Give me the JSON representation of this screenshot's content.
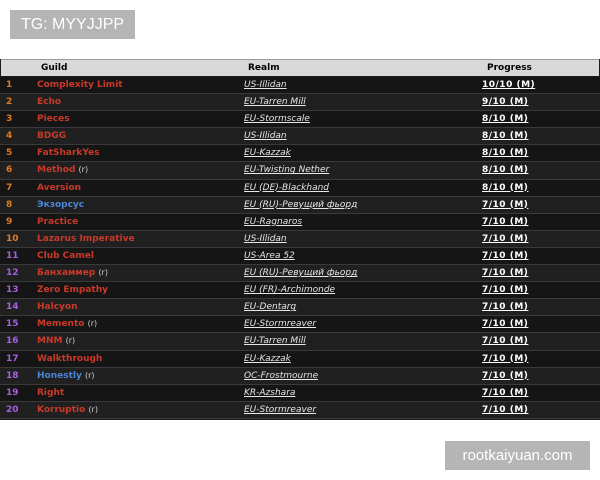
{
  "watermark_top": "TG: MYYJJPP",
  "watermark_bottom": "rootkaiyuan.com",
  "table": {
    "headers": {
      "guild": "Guild",
      "realm": "Realm",
      "progress": "Progress"
    },
    "colors": {
      "horde": "#c93a2a",
      "alliance": "#4a86d6",
      "rank_orange": "#e07a24",
      "rank_purple": "#a560e0",
      "rank_blue": "#4a86d6"
    },
    "rows": [
      {
        "rank": "1",
        "guild": "Complexity Limit",
        "suffix": "",
        "realm": "US-Illidan",
        "progress": "10/10 (M)",
        "rank_color": "#e07a24",
        "guild_color": "#c93a2a"
      },
      {
        "rank": "2",
        "guild": "Echo",
        "suffix": "",
        "realm": "EU-Tarren Mill",
        "progress": "9/10 (M)",
        "rank_color": "#e07a24",
        "guild_color": "#c93a2a"
      },
      {
        "rank": "3",
        "guild": "Pieces",
        "suffix": "",
        "realm": "EU-Stormscale",
        "progress": "8/10 (M)",
        "rank_color": "#e07a24",
        "guild_color": "#c93a2a"
      },
      {
        "rank": "4",
        "guild": "BDGG",
        "suffix": "",
        "realm": "US-Illidan",
        "progress": "8/10 (M)",
        "rank_color": "#e07a24",
        "guild_color": "#c93a2a"
      },
      {
        "rank": "5",
        "guild": "FatSharkYes",
        "suffix": "",
        "realm": "EU-Kazzak",
        "progress": "8/10 (M)",
        "rank_color": "#e07a24",
        "guild_color": "#c93a2a"
      },
      {
        "rank": "6",
        "guild": "Method",
        "suffix": "(r)",
        "realm": "EU-Twisting Nether",
        "progress": "8/10 (M)",
        "rank_color": "#e07a24",
        "guild_color": "#c93a2a"
      },
      {
        "rank": "7",
        "guild": "Aversion",
        "suffix": "",
        "realm": "EU (DE)-Blackhand",
        "progress": "8/10 (M)",
        "rank_color": "#e07a24",
        "guild_color": "#c93a2a"
      },
      {
        "rank": "8",
        "guild": "Экзорсус",
        "suffix": "",
        "realm": "EU (RU)-Ревущий фьорд",
        "progress": "7/10 (M)",
        "rank_color": "#e07a24",
        "guild_color": "#4a86d6"
      },
      {
        "rank": "9",
        "guild": "Practice",
        "suffix": "",
        "realm": "EU-Ragnaros",
        "progress": "7/10 (M)",
        "rank_color": "#e07a24",
        "guild_color": "#c93a2a"
      },
      {
        "rank": "10",
        "guild": "Lazarus Imperative",
        "suffix": "",
        "realm": "US-Illidan",
        "progress": "7/10 (M)",
        "rank_color": "#e07a24",
        "guild_color": "#c93a2a"
      },
      {
        "rank": "11",
        "guild": "Club Camel",
        "suffix": "",
        "realm": "US-Area 52",
        "progress": "7/10 (M)",
        "rank_color": "#a560e0",
        "guild_color": "#c93a2a"
      },
      {
        "rank": "12",
        "guild": "Банхаммер",
        "suffix": "(r)",
        "realm": "EU (RU)-Ревущий фьорд",
        "progress": "7/10 (M)",
        "rank_color": "#a560e0",
        "guild_color": "#c93a2a"
      },
      {
        "rank": "13",
        "guild": "Zero Empathy",
        "suffix": "",
        "realm": "EU (FR)-Archimonde",
        "progress": "7/10 (M)",
        "rank_color": "#a560e0",
        "guild_color": "#c93a2a"
      },
      {
        "rank": "14",
        "guild": "Halcyon",
        "suffix": "",
        "realm": "EU-Dentarg",
        "progress": "7/10 (M)",
        "rank_color": "#a560e0",
        "guild_color": "#c93a2a"
      },
      {
        "rank": "15",
        "guild": "Memento",
        "suffix": "(r)",
        "realm": "EU-Stormreaver",
        "progress": "7/10 (M)",
        "rank_color": "#a560e0",
        "guild_color": "#c93a2a"
      },
      {
        "rank": "16",
        "guild": "MNM",
        "suffix": "(r)",
        "realm": "EU-Tarren Mill",
        "progress": "7/10 (M)",
        "rank_color": "#a560e0",
        "guild_color": "#c93a2a"
      },
      {
        "rank": "17",
        "guild": "Walkthrough",
        "suffix": "",
        "realm": "EU-Kazzak",
        "progress": "7/10 (M)",
        "rank_color": "#a560e0",
        "guild_color": "#c93a2a"
      },
      {
        "rank": "18",
        "guild": "Honestly",
        "suffix": "(r)",
        "realm": "OC-Frostmourne",
        "progress": "7/10 (M)",
        "rank_color": "#a560e0",
        "guild_color": "#4a86d6"
      },
      {
        "rank": "19",
        "guild": "Right",
        "suffix": "",
        "realm": "KR-Azshara",
        "progress": "7/10 (M)",
        "rank_color": "#a560e0",
        "guild_color": "#c93a2a"
      },
      {
        "rank": "20",
        "guild": "Korruptio",
        "suffix": "(r)",
        "realm": "EU-Stormreaver",
        "progress": "7/10 (M)",
        "rank_color": "#a560e0",
        "guild_color": "#c93a2a"
      }
    ]
  }
}
